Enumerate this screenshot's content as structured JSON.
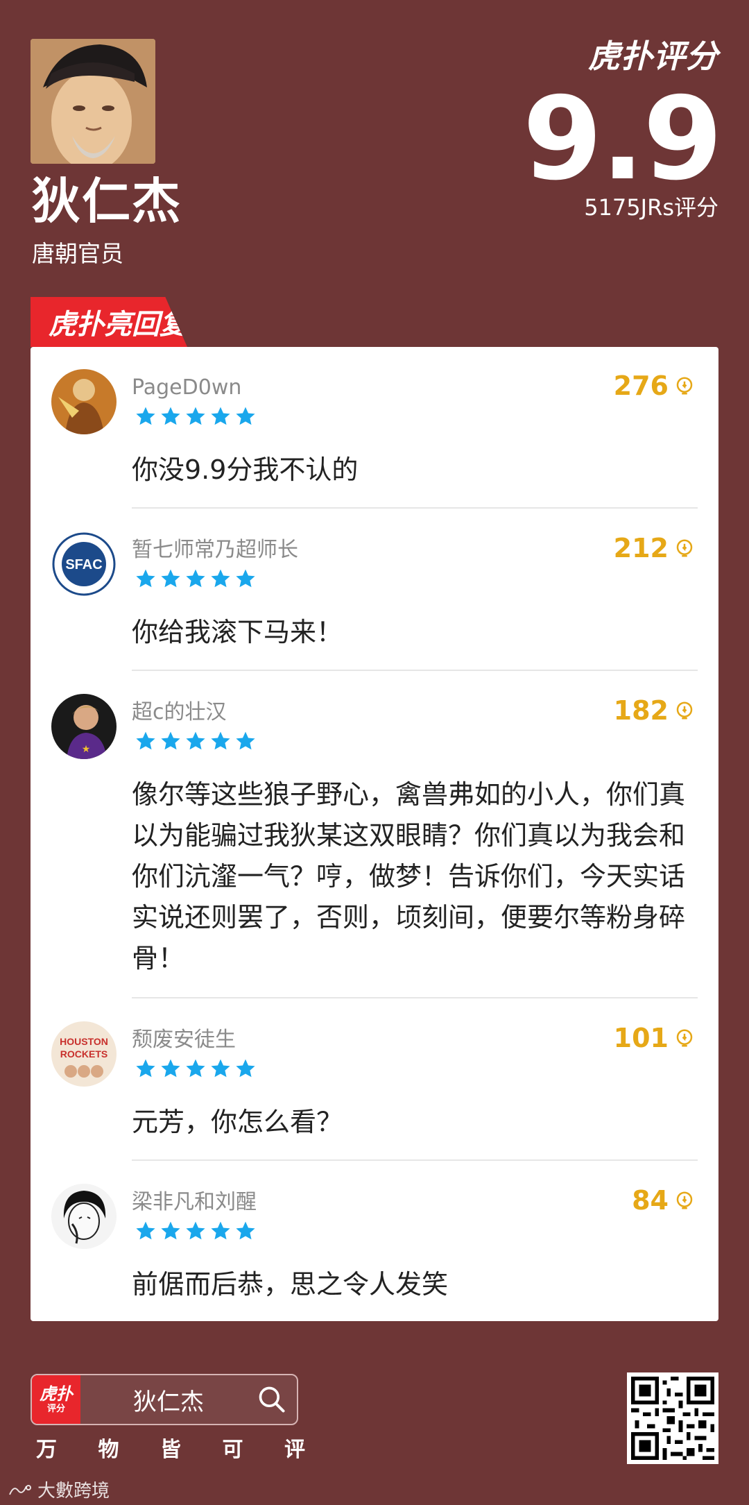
{
  "profile": {
    "name": "狄仁杰",
    "subtitle": "唐朝官员"
  },
  "rating": {
    "brand": "虎扑评分",
    "score": "9.9",
    "count": "5175JRs评分"
  },
  "section_tab": "虎扑亮回复",
  "comments": [
    {
      "user": "PageD0wn",
      "stars": 5,
      "likes": "276",
      "text": "你没9.9分我不认的"
    },
    {
      "user": "暂七师常乃超师长",
      "stars": 5,
      "likes": "212",
      "text": "你给我滚下马来！"
    },
    {
      "user": "超c的壮汉",
      "stars": 5,
      "likes": "182",
      "text": "像尔等这些狼子野心，禽兽弗如的小人，你们真以为能骗过我狄某这双眼睛？你们真以为我会和你们沆瀣一气？哼，做梦！告诉你们，今天实话实说还则罢了，否则，顷刻间，便要尔等粉身碎骨！"
    },
    {
      "user": "颓废安徒生",
      "stars": 5,
      "likes": "101",
      "text": "元芳，你怎么看？"
    },
    {
      "user": "梁非凡和刘醒",
      "stars": 5,
      "likes": "84",
      "text": "前倨而后恭，思之令人发笑"
    }
  ],
  "avatars": {
    "emblem_text": "SFAC",
    "team_text_1": "HOUSTON",
    "team_text_2": "ROCKETS"
  },
  "footer": {
    "search_logo": "虎扑",
    "search_logo_sub": "评分",
    "search_text": "狄仁杰",
    "slogan": [
      "万",
      "物",
      "皆",
      "可",
      "评"
    ],
    "watermark": "大數跨境"
  },
  "colors": {
    "background": "#6e3636",
    "accent_red": "#e8262c",
    "star_blue": "#1aa7ec",
    "likes_gold": "#e6a817"
  }
}
